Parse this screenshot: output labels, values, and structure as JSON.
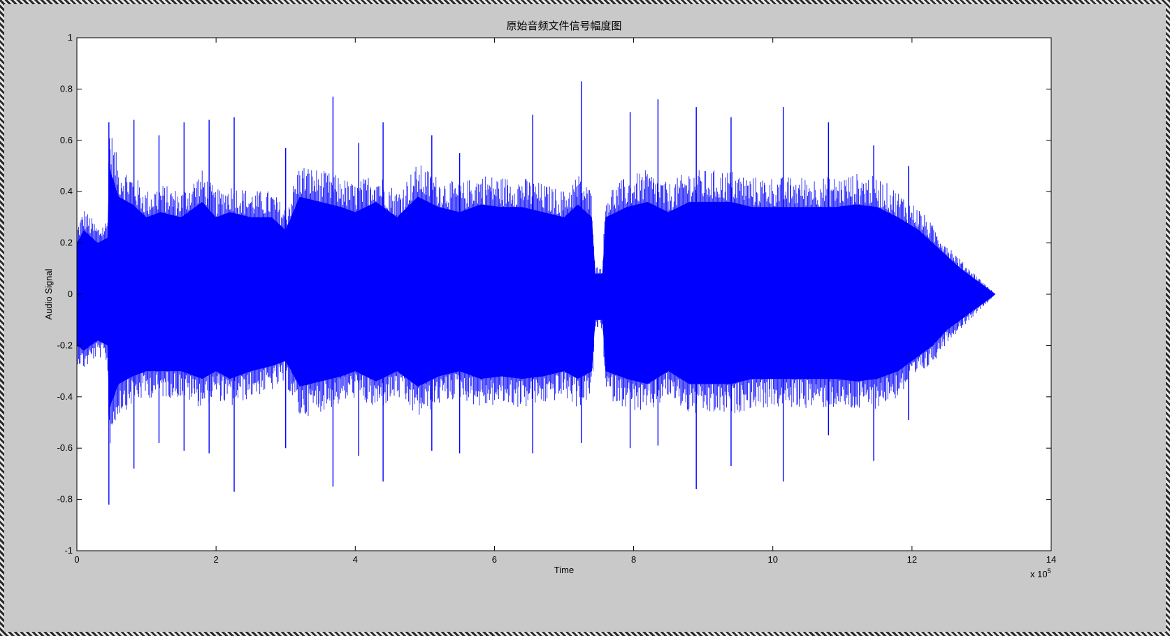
{
  "chart_data": {
    "type": "line",
    "title": "原始音频文件信号幅度图",
    "xlabel": "Time",
    "ylabel": "Audio Signal",
    "x_exponent_label": "x 10",
    "x_exponent_power": "5",
    "xlim": [
      0,
      14
    ],
    "ylim": [
      -1,
      1
    ],
    "x_ticks": [
      "0",
      "2",
      "4",
      "6",
      "8",
      "10",
      "12",
      "14"
    ],
    "y_ticks": [
      "-1",
      "-0.8",
      "-0.6",
      "-0.4",
      "-0.2",
      "0",
      "0.2",
      "0.4",
      "0.6",
      "0.8",
      "1"
    ],
    "grid": false,
    "series_color": "#0000ff",
    "series": [
      {
        "envelope": {
          "x": [
            0,
            0.1,
            0.3,
            0.44,
            0.46,
            0.6,
            0.8,
            1.0,
            1.2,
            1.5,
            1.8,
            2.0,
            2.2,
            2.5,
            2.8,
            3.0,
            3.2,
            3.5,
            3.8,
            4.0,
            4.3,
            4.6,
            4.9,
            5.2,
            5.5,
            5.8,
            6.1,
            6.4,
            6.7,
            7.0,
            7.2,
            7.4,
            7.45,
            7.55,
            7.6,
            7.9,
            8.2,
            8.5,
            8.8,
            9.1,
            9.4,
            9.7,
            10.0,
            10.3,
            10.6,
            10.9,
            11.2,
            11.5,
            11.8,
            12.1,
            12.3,
            12.5,
            12.7,
            12.9,
            13.1,
            13.2
          ],
          "upper": [
            0.2,
            0.25,
            0.2,
            0.22,
            0.5,
            0.38,
            0.35,
            0.3,
            0.32,
            0.3,
            0.36,
            0.3,
            0.32,
            0.3,
            0.3,
            0.25,
            0.38,
            0.36,
            0.34,
            0.32,
            0.36,
            0.3,
            0.38,
            0.34,
            0.32,
            0.35,
            0.34,
            0.34,
            0.32,
            0.3,
            0.35,
            0.3,
            0.08,
            0.08,
            0.3,
            0.34,
            0.36,
            0.32,
            0.36,
            0.36,
            0.36,
            0.34,
            0.34,
            0.34,
            0.34,
            0.34,
            0.35,
            0.34,
            0.3,
            0.25,
            0.2,
            0.15,
            0.1,
            0.06,
            0.02,
            0
          ],
          "lower": [
            -0.2,
            -0.22,
            -0.18,
            -0.2,
            -0.45,
            -0.35,
            -0.32,
            -0.3,
            -0.3,
            -0.3,
            -0.33,
            -0.3,
            -0.33,
            -0.3,
            -0.28,
            -0.26,
            -0.36,
            -0.34,
            -0.32,
            -0.3,
            -0.34,
            -0.3,
            -0.36,
            -0.32,
            -0.3,
            -0.33,
            -0.32,
            -0.33,
            -0.32,
            -0.3,
            -0.33,
            -0.3,
            -0.1,
            -0.1,
            -0.3,
            -0.33,
            -0.35,
            -0.3,
            -0.35,
            -0.35,
            -0.35,
            -0.33,
            -0.33,
            -0.33,
            -0.33,
            -0.33,
            -0.34,
            -0.33,
            -0.3,
            -0.24,
            -0.2,
            -0.14,
            -0.1,
            -0.06,
            -0.02,
            0
          ]
        },
        "spikes": [
          {
            "x": 0.46,
            "top": 0.67,
            "bottom": -0.82
          },
          {
            "x": 0.82,
            "top": 0.68,
            "bottom": -0.68
          },
          {
            "x": 1.18,
            "top": 0.62,
            "bottom": -0.58
          },
          {
            "x": 1.54,
            "top": 0.67,
            "bottom": -0.61
          },
          {
            "x": 1.9,
            "top": 0.68,
            "bottom": -0.62
          },
          {
            "x": 2.26,
            "top": 0.69,
            "bottom": -0.77
          },
          {
            "x": 3.0,
            "top": 0.57,
            "bottom": -0.6
          },
          {
            "x": 3.68,
            "top": 0.77,
            "bottom": -0.75
          },
          {
            "x": 4.05,
            "top": 0.59,
            "bottom": -0.63
          },
          {
            "x": 4.4,
            "top": 0.67,
            "bottom": -0.73
          },
          {
            "x": 5.1,
            "top": 0.62,
            "bottom": -0.61
          },
          {
            "x": 5.5,
            "top": 0.55,
            "bottom": -0.62
          },
          {
            "x": 6.55,
            "top": 0.7,
            "bottom": -0.62
          },
          {
            "x": 7.25,
            "top": 0.83,
            "bottom": -0.58
          },
          {
            "x": 7.95,
            "top": 0.71,
            "bottom": -0.6
          },
          {
            "x": 8.35,
            "top": 0.76,
            "bottom": -0.59
          },
          {
            "x": 8.9,
            "top": 0.73,
            "bottom": -0.76
          },
          {
            "x": 9.4,
            "top": 0.69,
            "bottom": -0.67
          },
          {
            "x": 10.15,
            "top": 0.73,
            "bottom": -0.73
          },
          {
            "x": 10.8,
            "top": 0.67,
            "bottom": -0.55
          },
          {
            "x": 11.45,
            "top": 0.58,
            "bottom": -0.65
          },
          {
            "x": 11.95,
            "top": 0.5,
            "bottom": -0.49
          },
          {
            "x": 12.7,
            "top": 0.1,
            "bottom": -0.08
          }
        ]
      }
    ]
  }
}
